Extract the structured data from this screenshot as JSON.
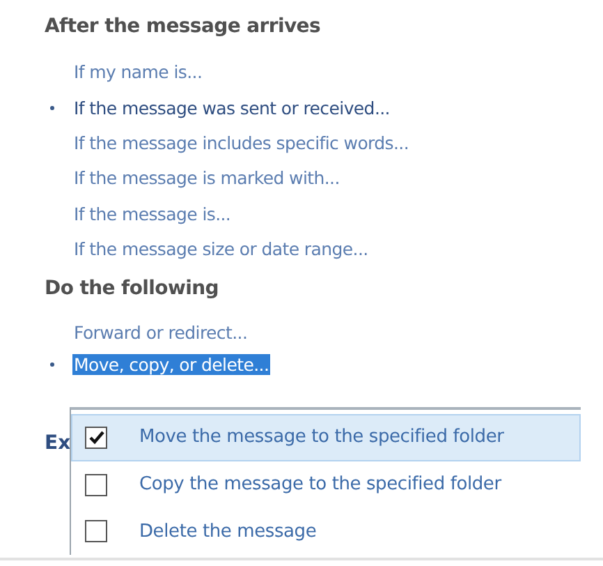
{
  "conditions": {
    "heading": "After the message arrives",
    "items": [
      {
        "label": "If my name is...",
        "selected": false
      },
      {
        "label": "If the message was sent or received...",
        "selected": true
      },
      {
        "label": "If the message includes specific words...",
        "selected": false
      },
      {
        "label": "If the message is marked with...",
        "selected": false
      },
      {
        "label": "If the message is...",
        "selected": false
      },
      {
        "label": "If the message size or date range...",
        "selected": false
      }
    ]
  },
  "actions": {
    "heading": "Do the following",
    "items": [
      {
        "label": "Forward or redirect...",
        "selected": false
      },
      {
        "label": "Move, copy, or delete...",
        "selected": true
      }
    ]
  },
  "exceptions": {
    "heading": "Ex"
  },
  "menu": {
    "items": [
      {
        "label": "Move the message to the specified folder",
        "checked": true,
        "highlighted": true
      },
      {
        "label": "Copy the message to the specified folder",
        "checked": false,
        "highlighted": false
      },
      {
        "label": "Delete the message",
        "checked": false,
        "highlighted": false
      }
    ]
  }
}
